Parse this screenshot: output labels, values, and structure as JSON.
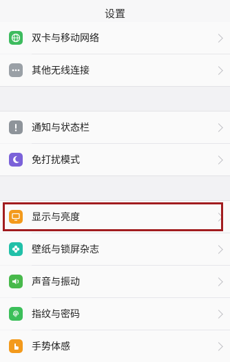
{
  "header": {
    "title": "设置"
  },
  "group1": [
    {
      "label": "双卡与移动网络",
      "icon": "globe-icon",
      "color": "#3dbb5e"
    },
    {
      "label": "其他无线连接",
      "icon": "more-icon",
      "color": "#9aa0a6"
    }
  ],
  "group2": [
    {
      "label": "通知与状态栏",
      "icon": "exclamation-icon",
      "color": "#8e949a"
    },
    {
      "label": "免打扰模式",
      "icon": "moon-icon",
      "color": "#7b62d9"
    }
  ],
  "group3": [
    {
      "label": "显示与亮度",
      "icon": "display-icon",
      "color": "#f39a1c"
    },
    {
      "label": "壁纸与锁屏杂志",
      "icon": "flower-icon",
      "color": "#21c0a8"
    },
    {
      "label": "声音与振动",
      "icon": "speaker-icon",
      "color": "#48b94b"
    },
    {
      "label": "指纹与密码",
      "icon": "fingerprint-icon",
      "color": "#3cbf5a"
    },
    {
      "label": "手势体感",
      "icon": "hand-icon",
      "color": "#f39a1c"
    }
  ],
  "highlight_color": "#a11c1f"
}
